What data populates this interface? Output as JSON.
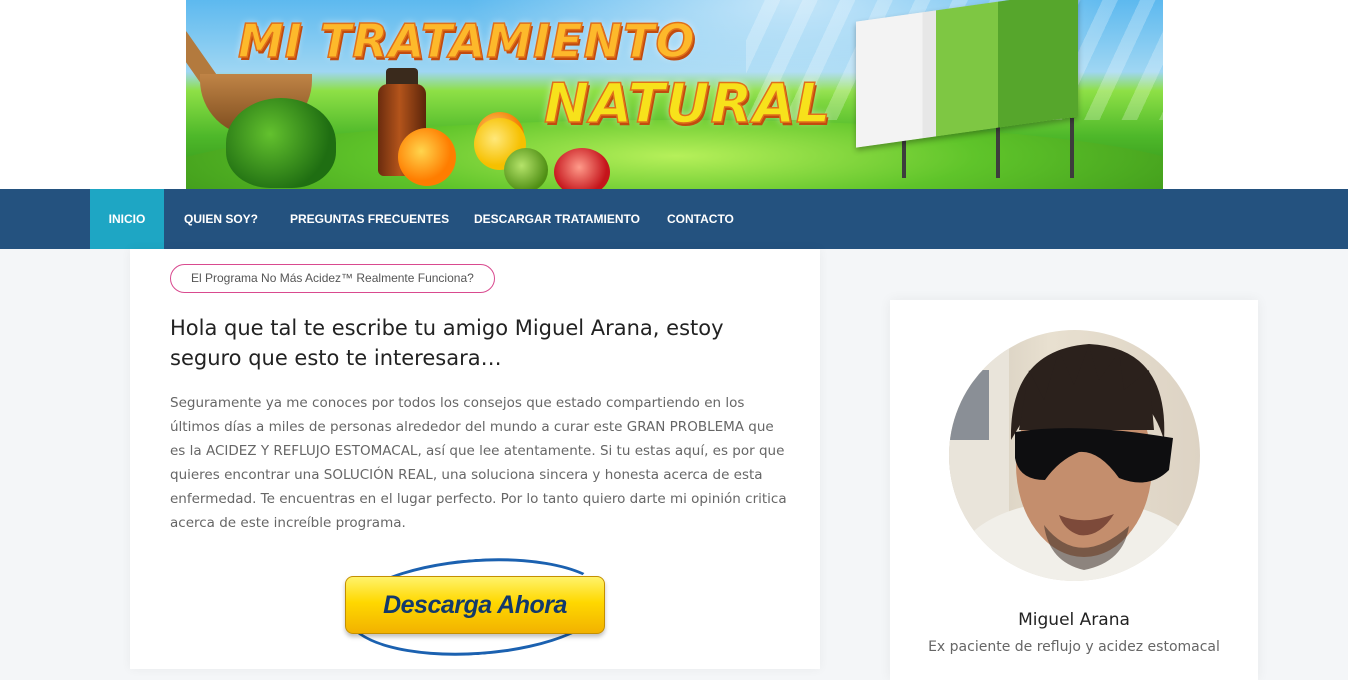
{
  "banner": {
    "title_line1": "MI TRATAMIENTO",
    "title_line2": "NATURAL"
  },
  "nav": {
    "items": [
      {
        "label": "INICIO",
        "active": true
      },
      {
        "label": "QUIEN SOY?",
        "active": false
      },
      {
        "label": "PREGUNTAS FRECUENTES",
        "active": false
      },
      {
        "label": "DESCARGAR TRATAMIENTO",
        "active": false
      },
      {
        "label": "CONTACTO",
        "active": false
      }
    ]
  },
  "main": {
    "pill_label": "El Programa No Más Acidez™ Realmente Funciona?",
    "headline": "Hola que tal te escribe tu amigo Miguel Arana, estoy seguro que esto te interesara…",
    "body": "Seguramente ya me conoces por todos los consejos que estado compartiendo en los últimos días a miles de personas alrededor del mundo a curar este GRAN PROBLEMA que es la ACIDEZ Y REFLUJO ESTOMACAL, así que lee atentamente. Si tu estas aquí, es por que quieres encontrar una SOLUCIÓN REAL, una soluciona sincera y honesta acerca de esta enfermedad. Te encuentras en el lugar perfecto. Por lo tanto quiero darte mi opinión critica acerca de este increíble programa.",
    "cta_label": "Descarga Ahora"
  },
  "sidebar": {
    "name": "Miguel Arana",
    "description": "Ex paciente de reflujo y acidez estomacal"
  },
  "colors": {
    "nav_bg": "#24527f",
    "nav_active": "#1ea6c4",
    "pill_border": "#d94a8f",
    "cta_yellow": "#ffd800",
    "cta_text": "#13396b"
  }
}
